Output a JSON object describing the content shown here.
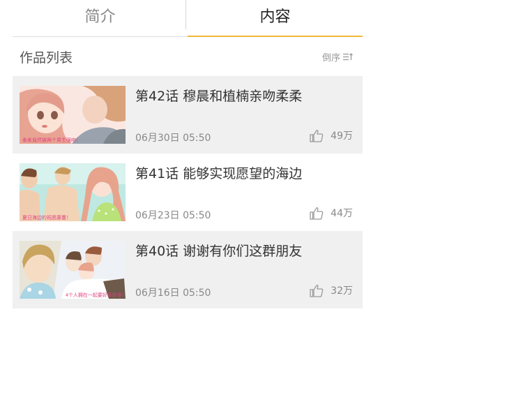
{
  "tabs": [
    {
      "label": "简介",
      "active": false
    },
    {
      "label": "内容",
      "active": true
    }
  ],
  "accent_color": "#f0b93b",
  "list": {
    "title": "作品列表",
    "sort_label": "倒序",
    "sort_icon": "sort-icon"
  },
  "episodes": [
    {
      "title": "第42话 穆晨和植楠亲吻柔柔",
      "date": "06月30日 05:50",
      "likes": "49万",
      "caption": "柔柔竟然被两个男生强吻！"
    },
    {
      "title": "第41话 能够实现愿望的海边",
      "date": "06月23日 05:50",
      "likes": "44万",
      "caption": "夏日海边的祝愿藤蔓！"
    },
    {
      "title": "第40话 谢谢有你们这群朋友",
      "date": "06月16日 05:50",
      "likes": "32万",
      "caption": "4个人拥在一起要好多好多！"
    }
  ]
}
